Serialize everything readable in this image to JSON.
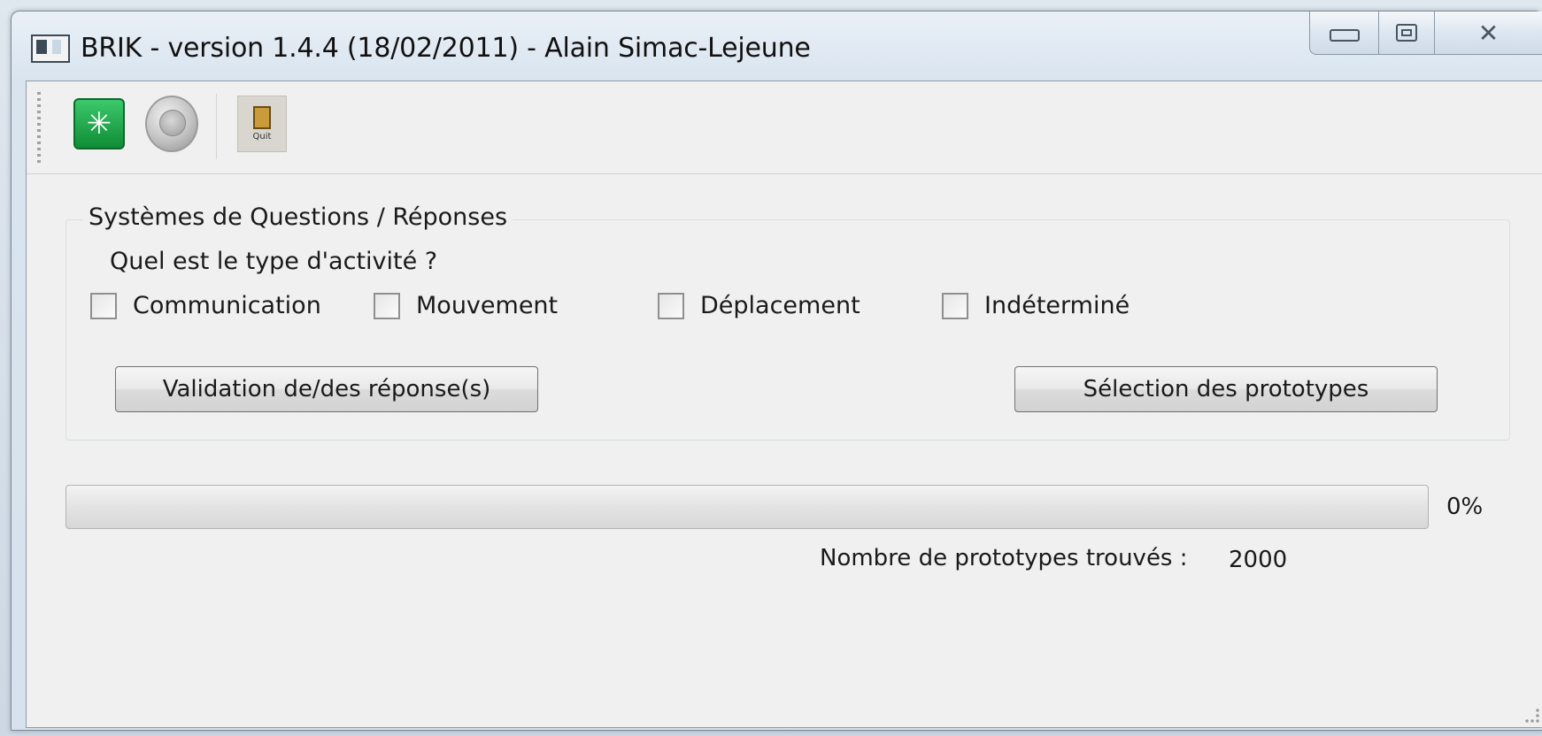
{
  "window": {
    "title": "BRIK - version 1.4.4 (18/02/2011) - Alain Simac-Lejeune",
    "controls": {
      "minimize_icon": "minimize-icon",
      "maximize_icon": "restore-icon",
      "close_glyph": "✕"
    }
  },
  "toolbar": {
    "start_icon": "start-icon",
    "start_glyph": "✳",
    "stop_icon": "stop-icon",
    "quit_icon": "quit-icon",
    "quit_label": "Quit"
  },
  "questions": {
    "group_title": "Systèmes de Questions / Réponses",
    "prompt": "Quel est le type d'activité ?",
    "options": [
      {
        "label": "Communication",
        "checked": false
      },
      {
        "label": "Mouvement",
        "checked": false
      },
      {
        "label": "Déplacement",
        "checked": false
      },
      {
        "label": "Indéterminé",
        "checked": false
      }
    ],
    "validate_label": "Validation de/des réponse(s)",
    "select_label": "Sélection des prototypes"
  },
  "progress": {
    "value": 0,
    "text": "0%",
    "fill_color": "#06b025"
  },
  "result": {
    "count_label": "Nombre de prototypes trouvés :",
    "count_value": "2000"
  }
}
